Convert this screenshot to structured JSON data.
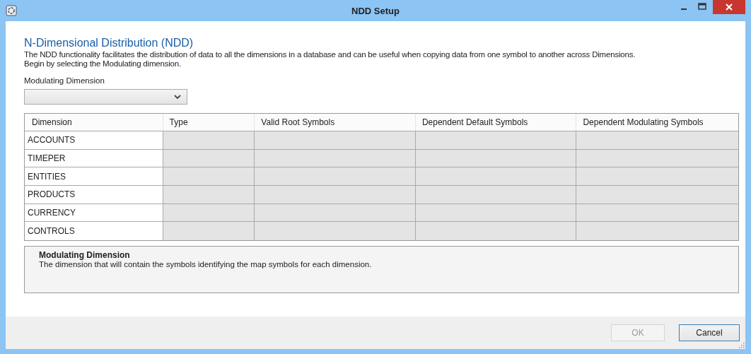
{
  "window": {
    "title": "NDD Setup"
  },
  "heading": "N-Dimensional Distribution (NDD)",
  "description": [
    "The NDD functionality facilitates the distribution of data to all the dimensions in a database and can be useful when copying data from one symbol to another across Dimensions.",
    "Begin by selecting the Modulating dimension."
  ],
  "modulating_dimension": {
    "label": "Modulating Dimension"
  },
  "table": {
    "columns": [
      "Dimension",
      "Type",
      "Valid Root Symbols",
      "Dependent Default Symbols",
      "Dependent Modulating Symbols"
    ],
    "rows": [
      {
        "dimension": "ACCOUNTS"
      },
      {
        "dimension": "TIMEPER"
      },
      {
        "dimension": "ENTITIES"
      },
      {
        "dimension": "PRODUCTS"
      },
      {
        "dimension": "CURRENCY"
      },
      {
        "dimension": "CONTROLS"
      }
    ]
  },
  "help": {
    "title": "Modulating Dimension",
    "text": "The dimension that will contain the symbols identifying the map symbols for each dimension."
  },
  "buttons": [
    {
      "label": "OK",
      "disabled": true,
      "focused": false
    },
    {
      "label": "Cancel",
      "disabled": false,
      "focused": true
    }
  ]
}
